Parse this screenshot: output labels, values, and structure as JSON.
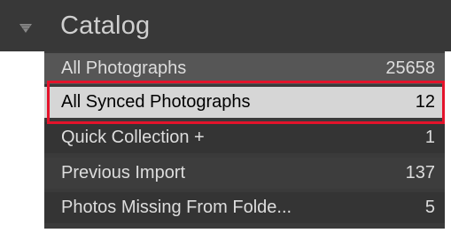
{
  "header": {
    "title": "Catalog"
  },
  "items": [
    {
      "label": "All Photographs",
      "count": "25658"
    },
    {
      "label": "All Synced Photographs",
      "count": "12"
    },
    {
      "label": "Quick Collection +",
      "count": "1"
    },
    {
      "label": "Previous Import",
      "count": "137"
    },
    {
      "label": "Photos Missing From Folde...",
      "count": "5"
    }
  ],
  "colors": {
    "header_bg": "#383838",
    "selected_row_bg": "#d6d6d6",
    "highlight_border": "#e4132b"
  },
  "icons": {
    "collapse": "triangle-down-icon"
  }
}
